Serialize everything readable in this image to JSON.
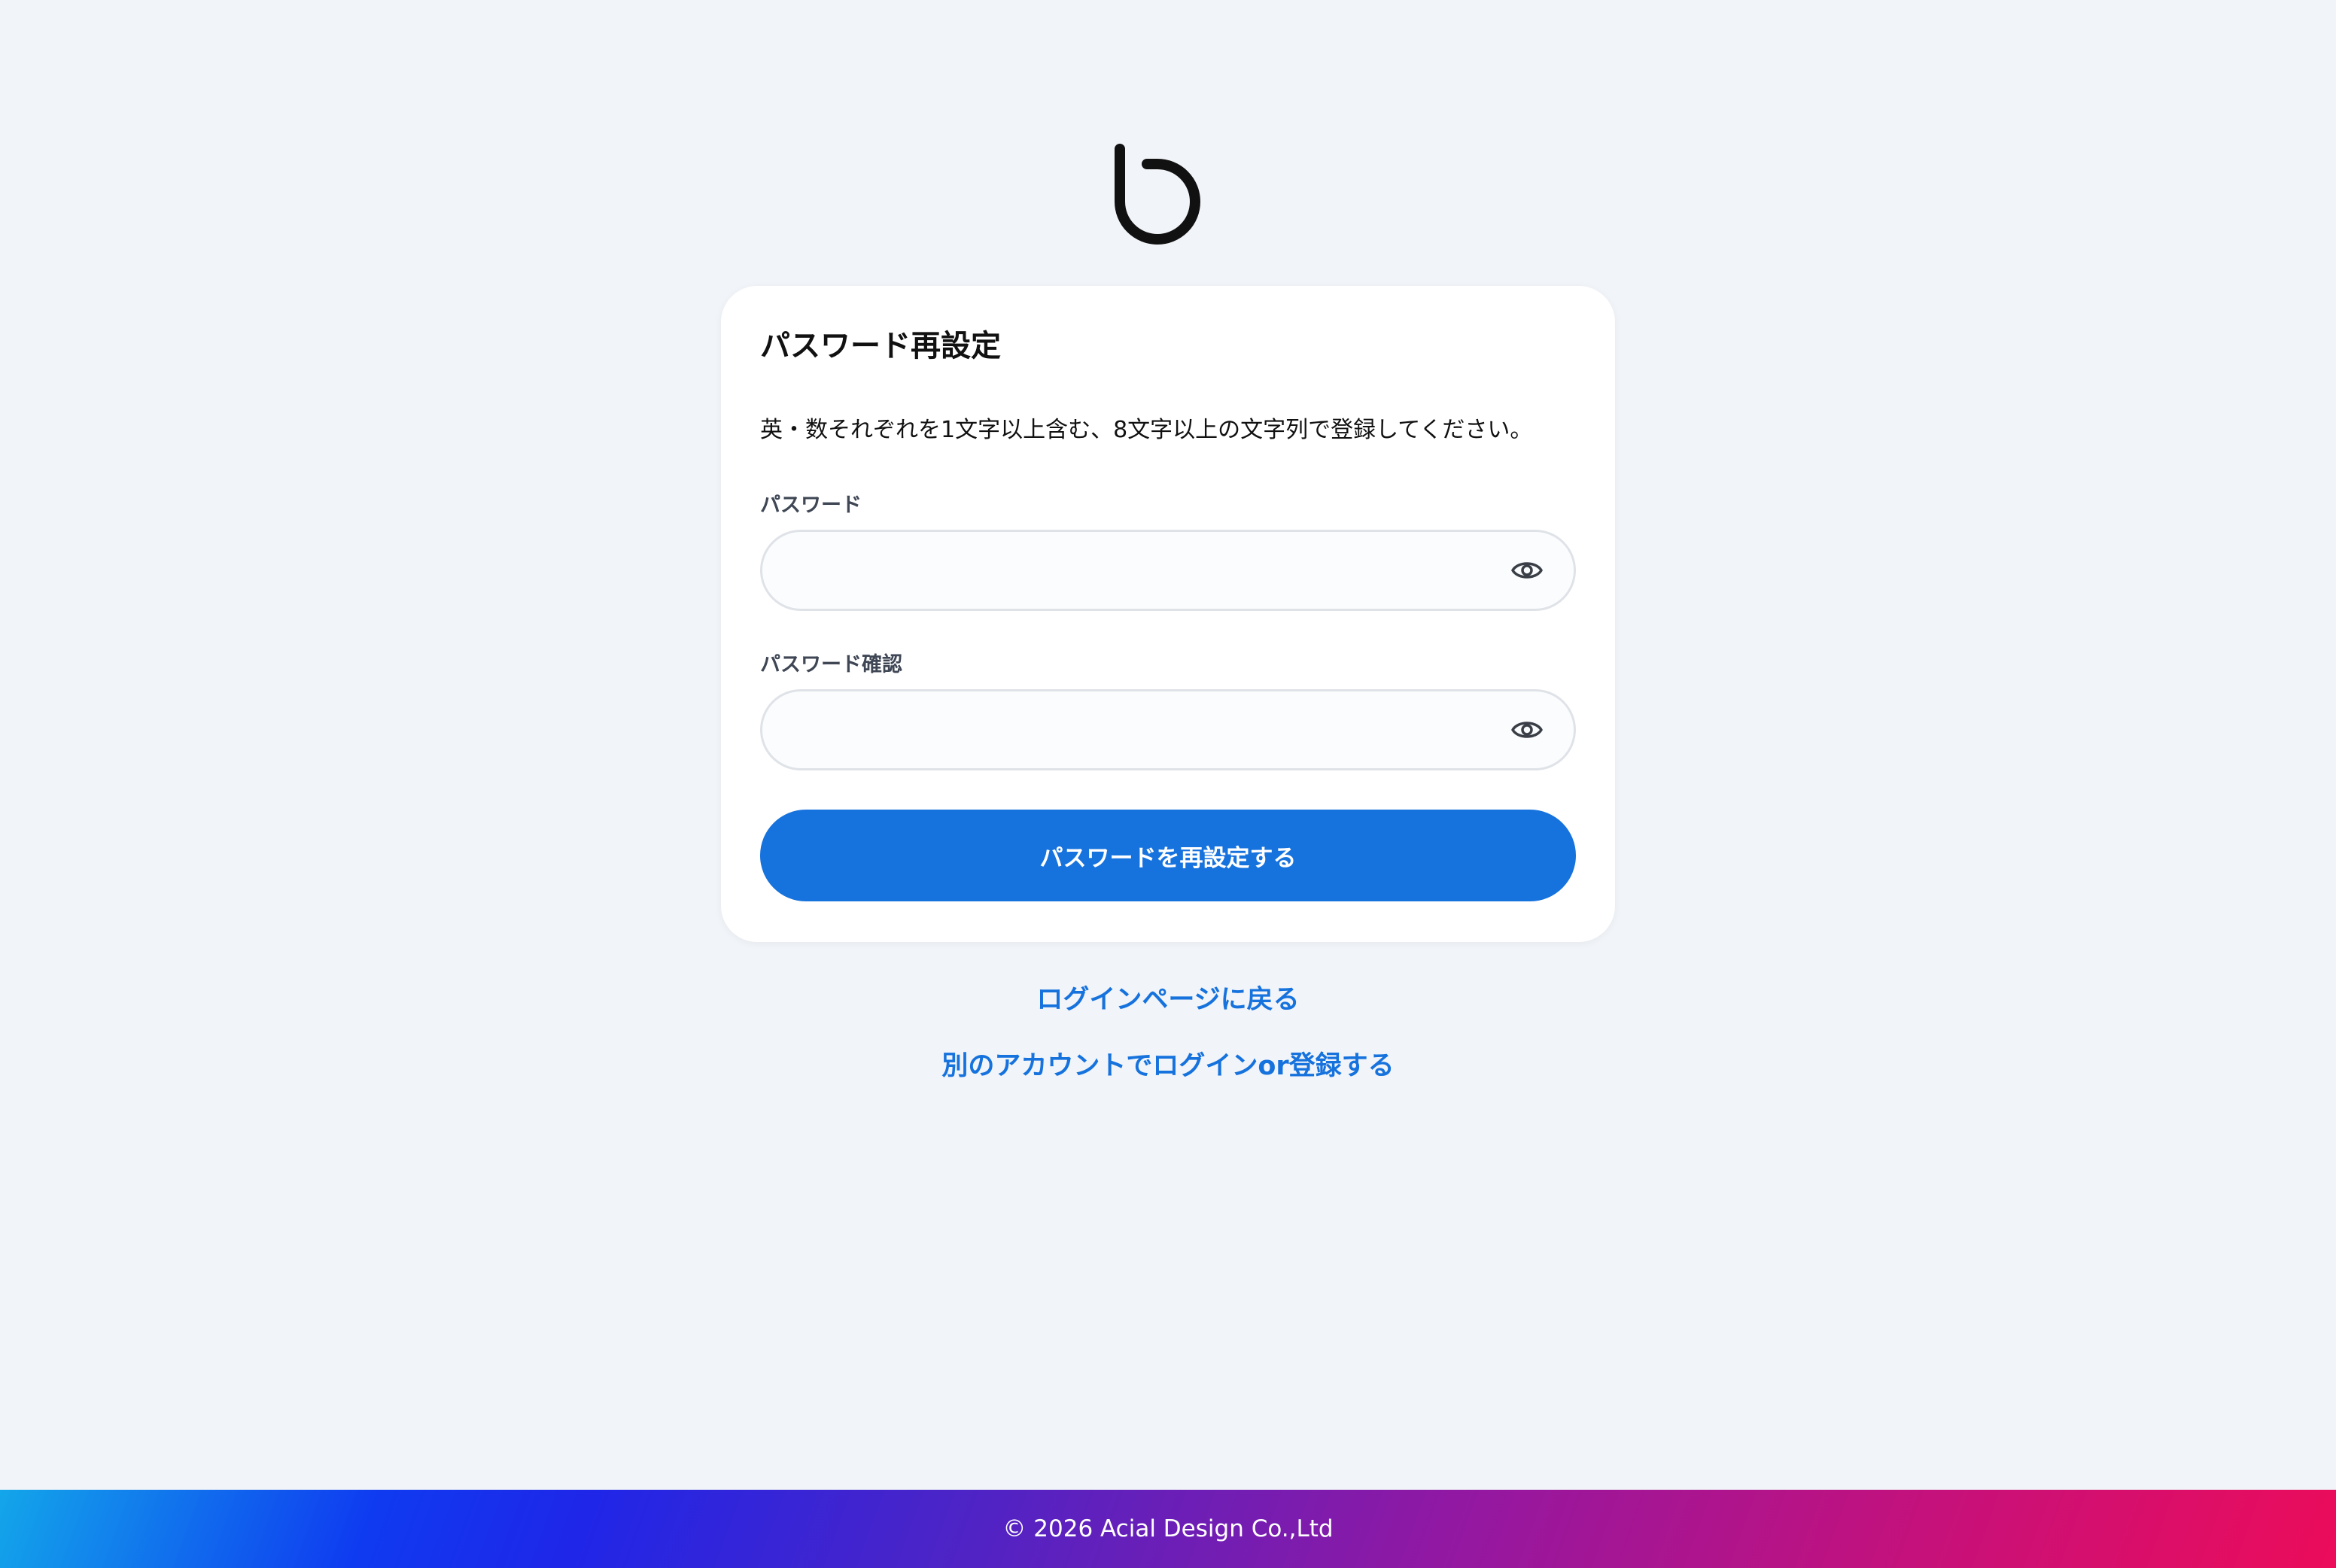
{
  "logo": {
    "icon": "b-plus-logo-icon"
  },
  "card": {
    "title": "パスワード再設定",
    "description": "英・数それぞれを1文字以上含む、8文字以上の文字列で登録してください。",
    "password_label": "パスワード",
    "password_value": "",
    "confirm_label": "パスワード確認",
    "confirm_value": "",
    "submit_label": "パスワードを再設定する"
  },
  "links": {
    "back_to_login": "ログインページに戻る",
    "other_account": "別のアカウントでログインor登録する"
  },
  "footer": {
    "copyright": "© 2026 Acial Design Co.,Ltd"
  },
  "colors": {
    "background": "#f1f4f8",
    "accent": "#1672dd",
    "card": "#ffffff",
    "footer_start": "#13a6ea",
    "footer_end": "#ec0c5a"
  }
}
